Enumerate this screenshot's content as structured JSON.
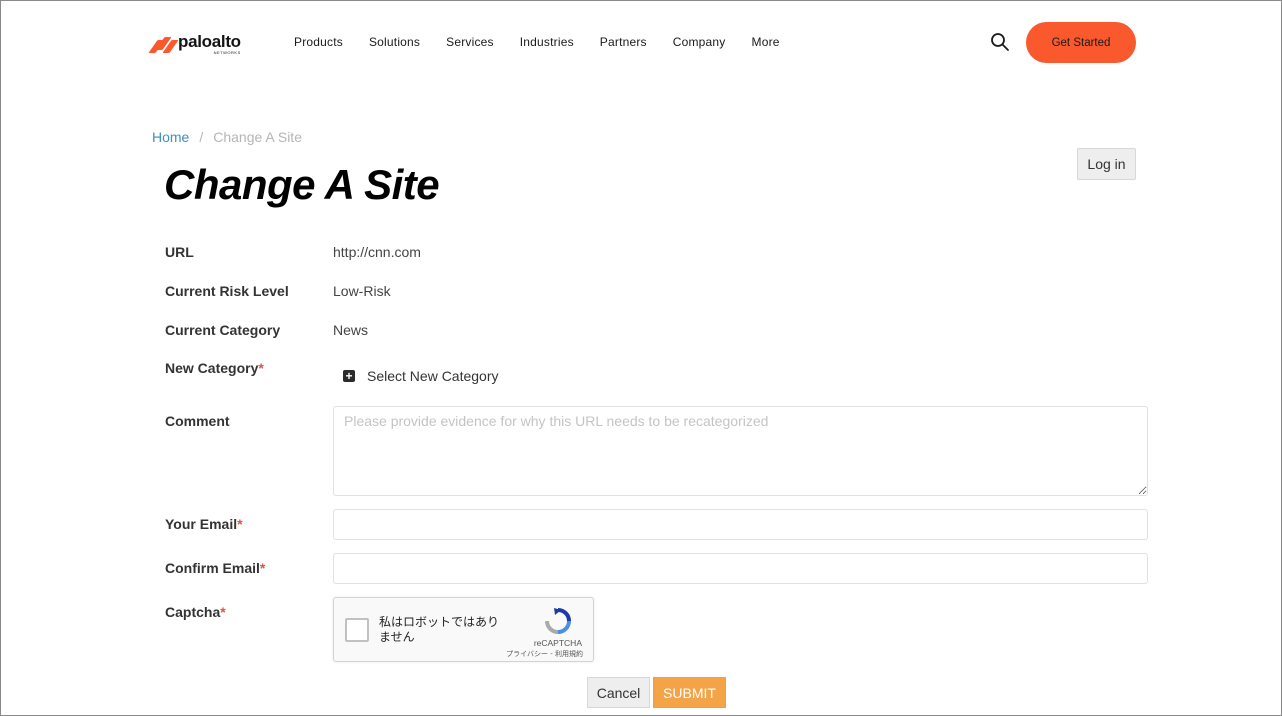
{
  "header": {
    "logo_text": "paloalto",
    "logo_sub": "NETWORKS",
    "nav": [
      "Products",
      "Solutions",
      "Services",
      "Industries",
      "Partners",
      "Company",
      "More"
    ],
    "cta_label": "Get Started",
    "accent_color": "#fa582d"
  },
  "breadcrumb": {
    "home": "Home",
    "separator": "/",
    "current": "Change A Site"
  },
  "login_label": "Log in",
  "page_title": "Change A Site",
  "form": {
    "url_label": "URL",
    "url_value": "http://cnn.com",
    "risk_label": "Current Risk Level",
    "risk_value": "Low-Risk",
    "category_label": "Current Category",
    "category_value": "News",
    "new_category_label": "New Category",
    "new_category_action": "Select New Category",
    "comment_label": "Comment",
    "comment_placeholder": "Please provide evidence for why this URL needs to be recategorized",
    "email_label": "Your Email",
    "email_value": "",
    "confirm_email_label": "Confirm Email",
    "confirm_email_value": "",
    "captcha_label": "Captcha",
    "required_mark": "*"
  },
  "captcha": {
    "text": "私はロボットではありません",
    "brand": "reCAPTCHA",
    "terms": "プライバシー - 利用規約"
  },
  "buttons": {
    "cancel": "Cancel",
    "submit": "SUBMIT"
  }
}
